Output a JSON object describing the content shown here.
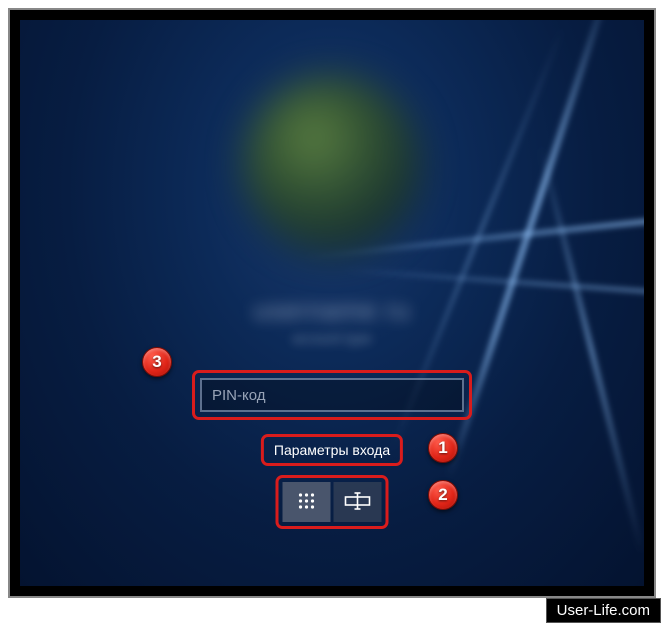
{
  "login": {
    "username_blur": "username  ru",
    "subtext_blur": "account type",
    "pin_placeholder": "PIN-код",
    "signin_options_label": "Параметры входа"
  },
  "markers": {
    "m1": "1",
    "m2": "2",
    "m3": "3"
  },
  "watermark": "User-Life.com"
}
